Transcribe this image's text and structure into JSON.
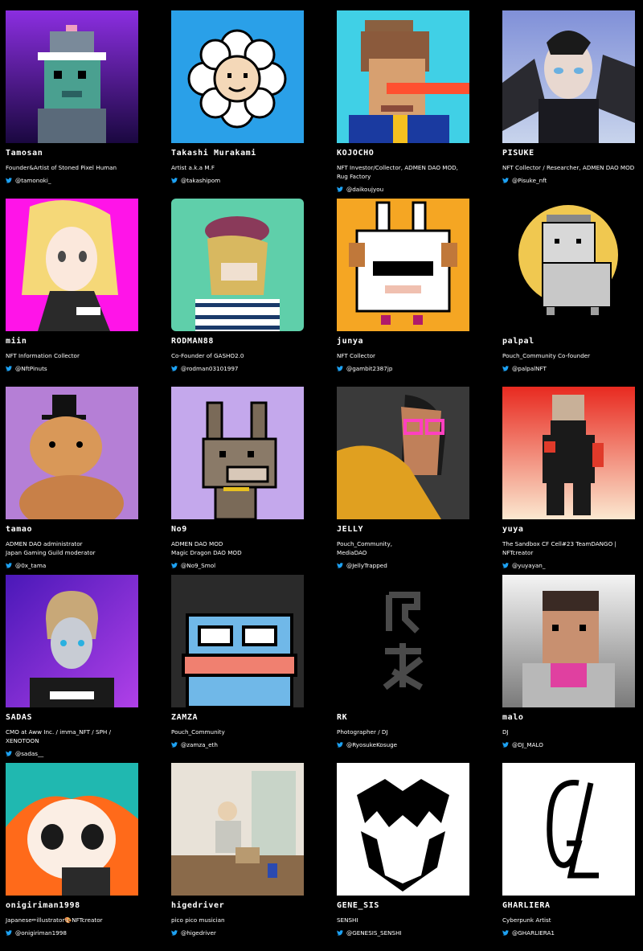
{
  "members": [
    {
      "name": "Tamosan",
      "bio": "Founder&Artist of Stoned Pixel Human",
      "handle": "@tamonoki_",
      "avatar": "pixel-human-icon",
      "bg": "#7a2bd6"
    },
    {
      "name": "Takashi Murakami",
      "bio": "Artist a.k.a M.F",
      "handle": "@takashipom",
      "avatar": "flower-face-icon",
      "bg": "#2aa0e8"
    },
    {
      "name": "KOJOCHO",
      "bio": "NFT Investor/Collector, ADMEN DAO MOD, Rug Factory",
      "handle": "@daikoujyou",
      "avatar": "laser-eye-punk-icon",
      "bg": "#40d0e6"
    },
    {
      "name": "PISUKE",
      "bio": "NFT Collector / Researcher, ADMEN DAO MOD",
      "handle": "@Pisuke_nft",
      "avatar": "3d-bat-wing-avatar-icon",
      "bg": "#9eaee0"
    },
    {
      "name": "miin",
      "bio": "NFT Information Collector",
      "handle": "@NftPinuts",
      "avatar": "anime-girl-icon",
      "bg": "#ff14e8"
    },
    {
      "name": "RODMAN88",
      "bio": "Co-Founder of GASHO2.0",
      "handle": "@rodman03101997",
      "avatar": "mutant-ape-icon",
      "bg": "#5fcfaa"
    },
    {
      "name": "junya",
      "bio": "NFT Collector",
      "handle": "@gambit2387jp",
      "avatar": "pixel-sheep-icon",
      "bg": "#f5a623"
    },
    {
      "name": "palpal",
      "bio": "Pouch_Community Co-founder",
      "handle": "@palpalNFT",
      "avatar": "pixel-dog-moon-icon",
      "bg": "#000000"
    },
    {
      "name": "tamao",
      "bio": "ADMEN DAO administrator\nJapan Gaming Guild moderator",
      "handle": "@0x_tama",
      "avatar": "cat-top-hat-icon",
      "bg": "#b57fd6"
    },
    {
      "name": "No9",
      "bio": "ADMEN DAO MOD\nMagic Dragon DAO MOD",
      "handle": "@No9_Smol",
      "avatar": "pixel-donkey-icon",
      "bg": "#c4a8ec"
    },
    {
      "name": "JELLY",
      "bio": "Pouch_Community,\nMediaDAO",
      "handle": "@JellyTrapped",
      "avatar": "samurai-glasses-icon",
      "bg": "#3a3a3a"
    },
    {
      "name": "yuya",
      "bio": "The Sandbox CF Cell#23 TeamDANGO |\nNFTcreator",
      "handle": "@yuyayan_",
      "avatar": "voxel-character-icon",
      "bg": "#f0412a"
    },
    {
      "name": "SADAS",
      "bio": "CMO at Aww Inc. / imma_NFT / SPH /\nXENOTOON",
      "handle": "@sadas__",
      "avatar": "3d-robot-girl-icon",
      "bg": "#6a22d0"
    },
    {
      "name": "ZAMZA",
      "bio": "Pouch_Community",
      "handle": "@zamza_eth",
      "avatar": "pixel-frog-icon",
      "bg": "#2a2a2a"
    },
    {
      "name": "RK",
      "bio": "Photographer / DJ",
      "handle": "@RyosukeKosuge",
      "avatar": "rk-logo-icon",
      "bg": "#000000"
    },
    {
      "name": "malo",
      "bio": "DJ",
      "handle": "@DJ_MALO",
      "avatar": "pixel-portrait-icon",
      "bg": "#e6e6e6"
    },
    {
      "name": "onigiriman1998",
      "bio": "Japanese✏illustrator🎨NFTcreator",
      "handle": "@onigiriman1998",
      "avatar": "teal-hair-girl-icon",
      "bg": "#ff6a1a"
    },
    {
      "name": "higedriver",
      "bio": "pico pico musician",
      "handle": "@higedriver",
      "avatar": "room-photo-icon",
      "bg": "#d8cfc0"
    },
    {
      "name": "GENE_SIS",
      "bio": "SENSHI",
      "handle": "@GENESIS_SENSHI",
      "avatar": "skull-logo-icon",
      "bg": "#ffffff"
    },
    {
      "name": "GHARLIERA",
      "bio": "Cyberpunk Artist",
      "handle": "@GHARLIERA1",
      "avatar": "gl-logo-icon",
      "bg": "#ffffff"
    }
  ],
  "colors": {
    "background": "#000000",
    "text": "#ffffff",
    "twitter": "#1da1f2"
  }
}
